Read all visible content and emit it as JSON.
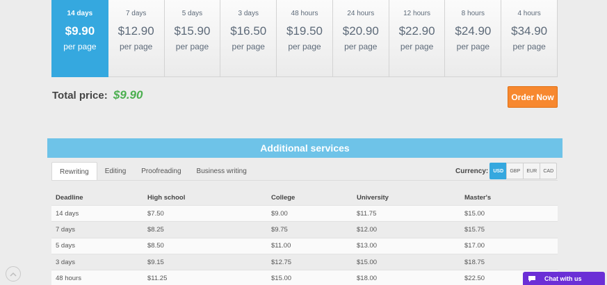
{
  "cards": [
    {
      "deadline": "14 days",
      "price": "$9.90",
      "unit": "per page",
      "active": true
    },
    {
      "deadline": "7 days",
      "price": "$12.90",
      "unit": "per page"
    },
    {
      "deadline": "5 days",
      "price": "$15.90",
      "unit": "per page"
    },
    {
      "deadline": "3 days",
      "price": "$16.50",
      "unit": "per page"
    },
    {
      "deadline": "48 hours",
      "price": "$19.50",
      "unit": "per page"
    },
    {
      "deadline": "24 hours",
      "price": "$20.90",
      "unit": "per page"
    },
    {
      "deadline": "12 hours",
      "price": "$22.90",
      "unit": "per page"
    },
    {
      "deadline": "8 hours",
      "price": "$24.90",
      "unit": "per page"
    },
    {
      "deadline": "4 hours",
      "price": "$34.90",
      "unit": "per page"
    }
  ],
  "total": {
    "label": "Total price:",
    "amount": "$9.90"
  },
  "order_button": "Order Now",
  "additional_title": "Additional services",
  "tabs": [
    "Rewriting",
    "Editing",
    "Proofreading",
    "Business writing"
  ],
  "currency": {
    "label": "Currency:",
    "options": [
      "USD",
      "GBP",
      "EUR",
      "CAD"
    ],
    "selected": "USD"
  },
  "table": {
    "headers": [
      "Deadline",
      "High school",
      "College",
      "University",
      "Master's"
    ],
    "rows": [
      [
        "14 days",
        "$7.50",
        "$9.00",
        "$11.75",
        "$15.00"
      ],
      [
        "7 days",
        "$8.25",
        "$9.75",
        "$12.00",
        "$15.75"
      ],
      [
        "5 days",
        "$8.50",
        "$11.00",
        "$13.00",
        "$17.00"
      ],
      [
        "3 days",
        "$9.15",
        "$12.75",
        "$15.00",
        "$18.75"
      ],
      [
        "48 hours",
        "$11.25",
        "$15.00",
        "$18.00",
        "$22.50"
      ]
    ]
  },
  "chat": {
    "label": "Chat with us",
    "icon": "chat-bubble-icon"
  },
  "scroll_top_icon": "chevron-up-icon",
  "colors": {
    "accent": "#35a8df",
    "order": "#f7882f",
    "bar": "#6ec3e8",
    "total": "#4caf50",
    "chat": "#6b2fd6"
  }
}
